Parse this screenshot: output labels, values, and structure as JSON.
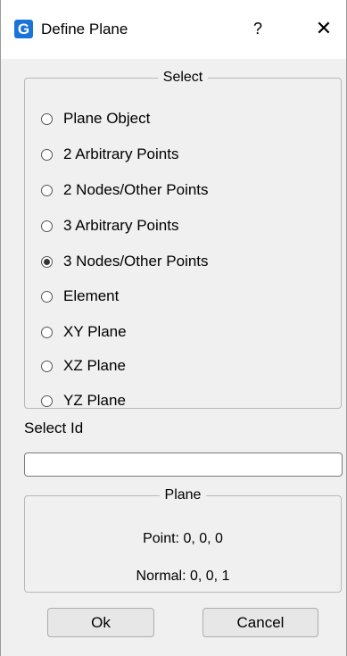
{
  "window": {
    "title": "Define Plane",
    "icon_letter": "G",
    "help_label": "?",
    "close_label": "✕",
    "accent_color": "#1a73d9"
  },
  "select_group": {
    "title": "Select",
    "options": [
      {
        "label": "Plane Object",
        "checked": false
      },
      {
        "label": "2 Arbitrary Points",
        "checked": false
      },
      {
        "label": "2 Nodes/Other Points",
        "checked": false
      },
      {
        "label": "3 Arbitrary Points",
        "checked": false
      },
      {
        "label": "3 Nodes/Other Points",
        "checked": true
      },
      {
        "label": "Element",
        "checked": false
      },
      {
        "label": "XY Plane",
        "checked": false
      },
      {
        "label": "XZ Plane",
        "checked": false
      },
      {
        "label": "YZ Plane",
        "checked": false
      }
    ]
  },
  "select_id": {
    "label": "Select Id",
    "value": "",
    "placeholder": ""
  },
  "plane_group": {
    "title": "Plane",
    "point": "Point: 0, 0, 0",
    "normal": "Normal: 0, 0, 1"
  },
  "buttons": {
    "ok": "Ok",
    "cancel": "Cancel"
  }
}
